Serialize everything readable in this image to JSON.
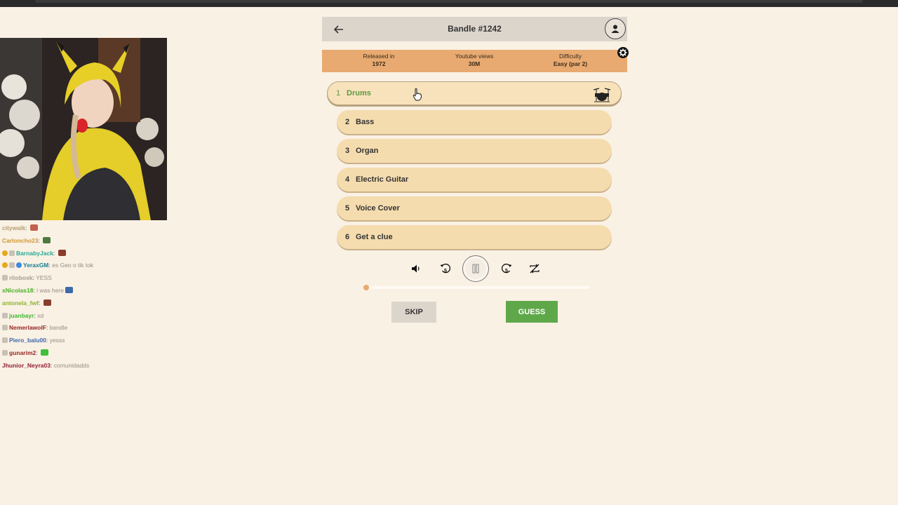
{
  "game": {
    "title": "Bandle #1242",
    "info": {
      "released_label": "Released in",
      "released_value": "1972",
      "views_label": "Youtube views",
      "views_value": "30M",
      "difficulty_label": "Difficulty",
      "difficulty_value": "Easy (par 2)"
    },
    "tracks": [
      {
        "num": "1",
        "label": "Drums",
        "active": true
      },
      {
        "num": "2",
        "label": "Bass"
      },
      {
        "num": "3",
        "label": "Organ"
      },
      {
        "num": "4",
        "label": "Electric Guitar"
      },
      {
        "num": "5",
        "label": "Voice Cover"
      },
      {
        "num": "6",
        "label": "Get a clue"
      }
    ],
    "controls": {
      "rewind_label": "5",
      "forward_label": "5"
    },
    "progress": 0.02,
    "skip_label": "SKIP",
    "guess_label": "GUESS",
    "accent_color": "#e8aa70",
    "guess_color": "#5fa84a"
  },
  "chat": [
    {
      "user": "citywalk",
      "user_color": "#c0a97a",
      "message": "",
      "badges": [],
      "emote": "#c0624d"
    },
    {
      "user": "Carloncho23",
      "user_color": "#d9a13b",
      "message": "",
      "badges": [],
      "emote": "#4a7a3f"
    },
    {
      "user": "BarnabyJack",
      "user_color": "#2cb5a0",
      "message": "",
      "badges": [
        "gold",
        "tier"
      ],
      "emote": "#8a3c2d"
    },
    {
      "user": "YeraxGM",
      "user_color": "#1f8a9c",
      "message": "es Geo o tik tok",
      "badges": [
        "gold",
        "tier",
        "blue"
      ]
    },
    {
      "user": "ritobosk",
      "user_color": "#b0a799",
      "message": "YESS",
      "badges": [
        "tier"
      ]
    },
    {
      "user": "xNicolas18",
      "user_color": "#55b833",
      "message": "i was here",
      "badges": [],
      "emote": "#3e6aa8"
    },
    {
      "user": "antonela_fwf",
      "user_color": "#9bbd3a",
      "message": "",
      "badges": [],
      "emote": "#8a3c2d"
    },
    {
      "user": "juanbayr",
      "user_color": "#49c23b",
      "message": "xd",
      "badges": [
        "tier"
      ]
    },
    {
      "user": "NemerlawolF",
      "user_color": "#a1322d",
      "message": "bandle",
      "badges": [
        "tier"
      ]
    },
    {
      "user": "Piero_balu00",
      "user_color": "#4a72b5",
      "message": "yesss",
      "badges": [
        "tier"
      ]
    },
    {
      "user": "gunarim2",
      "user_color": "#a1322d",
      "message": "",
      "badges": [
        "tier"
      ],
      "emote": "#3fbf3a"
    },
    {
      "user": "Jhunior_Neyra03",
      "user_color": "#9c2a3d",
      "message": "comunidadds",
      "badges": []
    }
  ]
}
